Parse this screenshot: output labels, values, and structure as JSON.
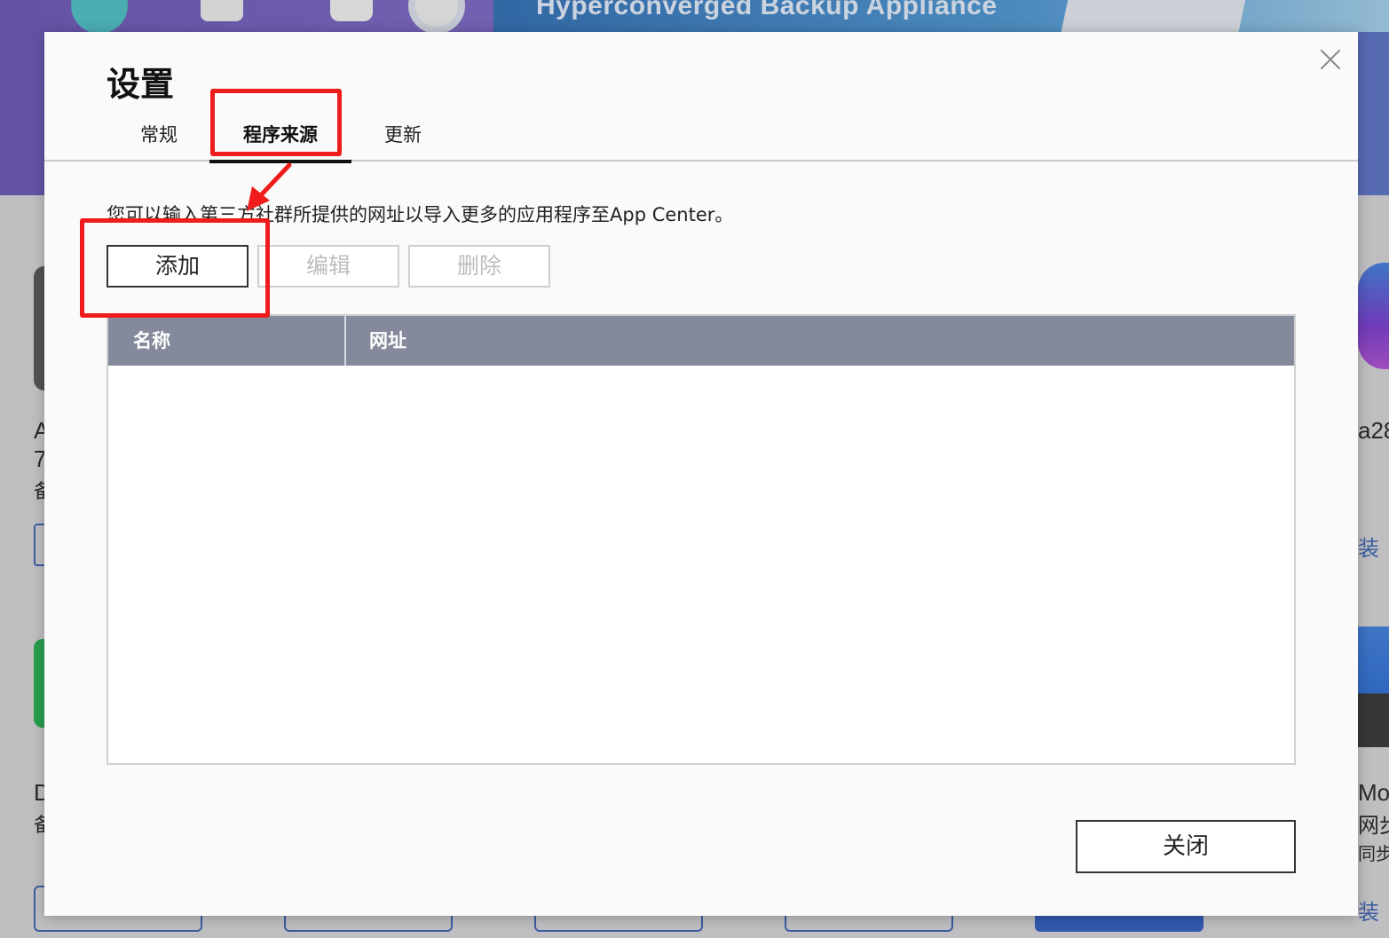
{
  "background": {
    "banner_text": "Hyperconverged Backup Appliance",
    "right_texts": [
      "a28",
      "装",
      "Mo",
      "网步",
      "同步",
      "装"
    ],
    "left_texts": [
      "A",
      "7",
      "备",
      "D",
      "备"
    ]
  },
  "modal": {
    "title": "设置",
    "tabs": [
      {
        "label": "常规",
        "active": false
      },
      {
        "label": "程序来源",
        "active": true
      },
      {
        "label": "更新",
        "active": false
      }
    ],
    "description": "您可以输入第三方社群所提供的网址以导入更多的应用程序至App Center。",
    "toolbar": {
      "add_label": "添加",
      "edit_label": "编辑",
      "delete_label": "删除"
    },
    "table": {
      "columns": [
        "名称",
        "网址"
      ],
      "rows": []
    },
    "close_label": "关闭"
  },
  "colors": {
    "annotation": "#f01c1c",
    "table_header": "#848a9c",
    "banner": "#6a55b8"
  }
}
